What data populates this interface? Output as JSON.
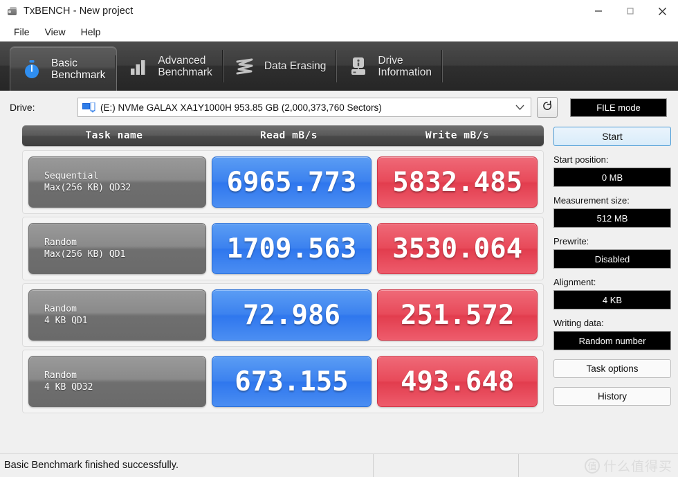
{
  "window": {
    "title": "TxBENCH - New project",
    "app_icon": "hard-disk-icon",
    "controls": {
      "minimize": "–",
      "maximize": "□",
      "close": "×"
    }
  },
  "menubar": {
    "items": [
      {
        "label": "File"
      },
      {
        "label": "View"
      },
      {
        "label": "Help"
      }
    ]
  },
  "tabs": [
    {
      "label": "Basic\nBenchmark",
      "icon": "stopwatch-icon",
      "active": true
    },
    {
      "label": "Advanced\nBenchmark",
      "icon": "bar-chart-icon",
      "active": false
    },
    {
      "label": "Data Erasing",
      "icon": "eraser-wave-icon",
      "active": false
    },
    {
      "label": "Drive\nInformation",
      "icon": "drive-info-icon",
      "active": false
    }
  ],
  "drive_row": {
    "label": "Drive:",
    "selected": "(E:) NVMe GALAX XA1Y1000H  953.85 GB (2,000,373,760 Sectors)",
    "device_icon": "disk-drive-icon",
    "dropdown_icon": "chevron-down-icon",
    "refresh_icon": "refresh-icon",
    "file_mode_label": "FILE mode"
  },
  "table": {
    "headers": {
      "task": "Task name",
      "read": "Read mB/s",
      "write": "Write mB/s"
    },
    "rows": [
      {
        "task": "Sequential\nMax(256 KB) QD32",
        "read": "6965.773",
        "write": "5832.485"
      },
      {
        "task": "Random\nMax(256 KB) QD1",
        "read": "1709.563",
        "write": "3530.064"
      },
      {
        "task": "Random\n4 KB QD1",
        "read": "72.986",
        "write": "251.572"
      },
      {
        "task": "Random\n4 KB QD32",
        "read": "673.155",
        "write": "493.648"
      }
    ]
  },
  "side_panel": {
    "start_label": "Start",
    "start_position_label": "Start position:",
    "start_position_value": "0 MB",
    "measurement_size_label": "Measurement size:",
    "measurement_size_value": "512 MB",
    "prewrite_label": "Prewrite:",
    "prewrite_value": "Disabled",
    "alignment_label": "Alignment:",
    "alignment_value": "4 KB",
    "writing_data_label": "Writing data:",
    "writing_data_value": "Random number",
    "task_options_label": "Task options",
    "history_label": "History"
  },
  "statusbar": {
    "message": "Basic Benchmark finished successfully.",
    "segment2": "",
    "segment3": ""
  },
  "watermark": {
    "badge": "值",
    "text": "什么值得买"
  },
  "colors": {
    "read_accent": "#3c82ef",
    "write_accent": "#e84a5a",
    "tab_bar": "#3c3c3c",
    "start_button_border": "#4a9ad4"
  }
}
